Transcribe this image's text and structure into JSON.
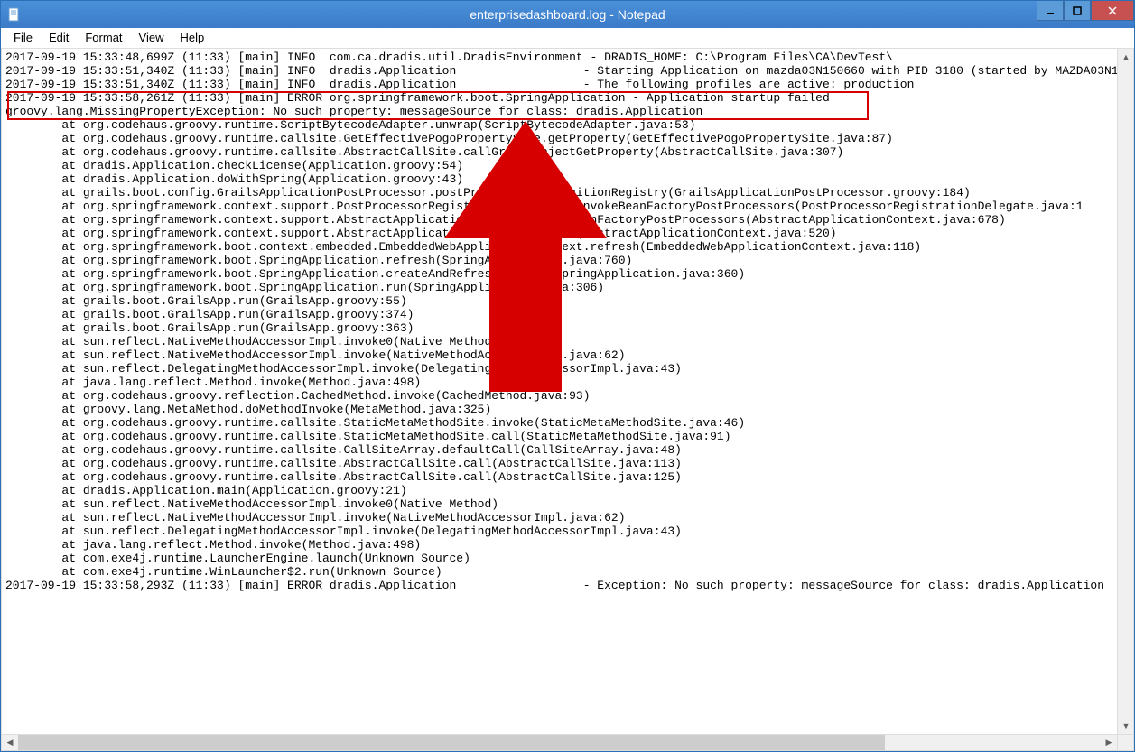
{
  "window": {
    "title": "enterprisedashboard.log - Notepad"
  },
  "menu": {
    "file": "File",
    "edit": "Edit",
    "format": "Format",
    "view": "View",
    "help": "Help"
  },
  "log_lines": [
    "2017-09-19 15:33:48,699Z (11:33) [main] INFO  com.ca.dradis.util.DradisEnvironment - DRADIS_HOME: C:\\Program Files\\CA\\DevTest\\",
    "2017-09-19 15:33:51,340Z (11:33) [main] INFO  dradis.Application                  - Starting Application on mazda03N150660 with PID 3180 (started by MAZDA03N1",
    "2017-09-19 15:33:51,340Z (11:33) [main] INFO  dradis.Application                  - The following profiles are active: production",
    "2017-09-19 15:33:58,261Z (11:33) [main] ERROR org.springframework.boot.SpringApplication - Application startup failed",
    "groovy.lang.MissingPropertyException: No such property: messageSource for class: dradis.Application",
    "        at org.codehaus.groovy.runtime.ScriptBytecodeAdapter.unwrap(ScriptBytecodeAdapter.java:53)",
    "        at org.codehaus.groovy.runtime.callsite.GetEffectivePogoPropertySite.getProperty(GetEffectivePogoPropertySite.java:87)",
    "        at org.codehaus.groovy.runtime.callsite.AbstractCallSite.callGroovyObjectGetProperty(AbstractCallSite.java:307)",
    "        at dradis.Application.checkLicense(Application.groovy:54)",
    "        at dradis.Application.doWithSpring(Application.groovy:43)",
    "        at grails.boot.config.GrailsApplicationPostProcessor.postProcessBeanDefinitionRegistry(GrailsApplicationPostProcessor.groovy:184)",
    "        at org.springframework.context.support.PostProcessorRegistrationDelegate.invokeBeanFactoryPostProcessors(PostProcessorRegistrationDelegate.java:1",
    "        at org.springframework.context.support.AbstractApplicationContext.invokeBeanFactoryPostProcessors(AbstractApplicationContext.java:678)",
    "        at org.springframework.context.support.AbstractApplicationContext.refresh(AbstractApplicationContext.java:520)",
    "        at org.springframework.boot.context.embedded.EmbeddedWebApplicationContext.refresh(EmbeddedWebApplicationContext.java:118)",
    "        at org.springframework.boot.SpringApplication.refresh(SpringApplication.java:760)",
    "        at org.springframework.boot.SpringApplication.createAndRefreshContext(SpringApplication.java:360)",
    "        at org.springframework.boot.SpringApplication.run(SpringApplication.java:306)",
    "        at grails.boot.GrailsApp.run(GrailsApp.groovy:55)",
    "        at grails.boot.GrailsApp.run(GrailsApp.groovy:374)",
    "        at grails.boot.GrailsApp.run(GrailsApp.groovy:363)",
    "        at sun.reflect.NativeMethodAccessorImpl.invoke0(Native Method)",
    "        at sun.reflect.NativeMethodAccessorImpl.invoke(NativeMethodAccessorImpl.java:62)",
    "        at sun.reflect.DelegatingMethodAccessorImpl.invoke(DelegatingMethodAccessorImpl.java:43)",
    "        at java.lang.reflect.Method.invoke(Method.java:498)",
    "        at org.codehaus.groovy.reflection.CachedMethod.invoke(CachedMethod.java:93)",
    "        at groovy.lang.MetaMethod.doMethodInvoke(MetaMethod.java:325)",
    "        at org.codehaus.groovy.runtime.callsite.StaticMetaMethodSite.invoke(StaticMetaMethodSite.java:46)",
    "        at org.codehaus.groovy.runtime.callsite.StaticMetaMethodSite.call(StaticMetaMethodSite.java:91)",
    "        at org.codehaus.groovy.runtime.callsite.CallSiteArray.defaultCall(CallSiteArray.java:48)",
    "        at org.codehaus.groovy.runtime.callsite.AbstractCallSite.call(AbstractCallSite.java:113)",
    "        at org.codehaus.groovy.runtime.callsite.AbstractCallSite.call(AbstractCallSite.java:125)",
    "        at dradis.Application.main(Application.groovy:21)",
    "        at sun.reflect.NativeMethodAccessorImpl.invoke0(Native Method)",
    "        at sun.reflect.NativeMethodAccessorImpl.invoke(NativeMethodAccessorImpl.java:62)",
    "        at sun.reflect.DelegatingMethodAccessorImpl.invoke(DelegatingMethodAccessorImpl.java:43)",
    "        at java.lang.reflect.Method.invoke(Method.java:498)",
    "        at com.exe4j.runtime.LauncherEngine.launch(Unknown Source)",
    "        at com.exe4j.runtime.WinLauncher$2.run(Unknown Source)",
    "2017-09-19 15:33:58,293Z (11:33) [main] ERROR dradis.Application                  - Exception: No such property: messageSource for class: dradis.Application"
  ],
  "annotation": {
    "highlight_color": "#d60000",
    "arrow_color": "#d60000"
  }
}
